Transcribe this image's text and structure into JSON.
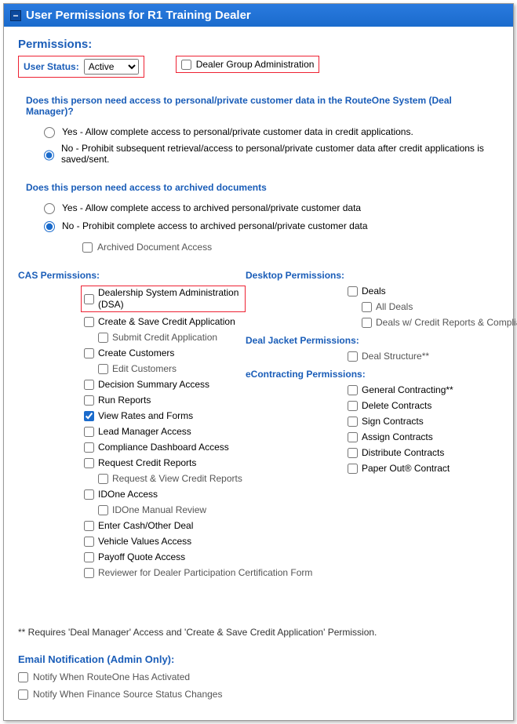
{
  "title": "User Permissions for R1 Training Dealer",
  "permissionsHeading": "Permissions:",
  "userStatus": {
    "label": "User Status:",
    "value": "Active"
  },
  "dealerGroupAdmin": "Dealer Group Administration",
  "q1": {
    "heading": "Does this person need access to personal/private customer data in the RouteOne System (Deal Manager)?",
    "yes": "Yes - Allow complete access to personal/private customer data in credit applications.",
    "no": "No - Prohibit subsequent retrieval/access to personal/private customer data after credit applications is saved/sent."
  },
  "q2": {
    "heading": "Does this person need access to archived documents",
    "yes": "Yes - Allow complete access to archived personal/private customer data",
    "no": "No - Prohibit complete access to archived personal/private customer data",
    "archived": "Archived Document Access"
  },
  "casHeading": "CAS Permissions:",
  "cas": {
    "dsa": "Dealership System Administration (DSA)",
    "createSave": "Create & Save Credit Application",
    "submit": "Submit Credit Application",
    "createCust": "Create Customers",
    "editCust": "Edit Customers",
    "decision": "Decision Summary Access",
    "runReports": "Run Reports",
    "viewRates": "View Rates and Forms",
    "leadMgr": "Lead Manager Access",
    "compliance": "Compliance Dashboard Access",
    "reqCredit": "Request Credit Reports",
    "reqView": "Request & View Credit Reports",
    "idone": "IDOne Access",
    "idoneManual": "IDOne Manual Review",
    "enterCash": "Enter Cash/Other Deal",
    "vehicleValues": "Vehicle Values Access",
    "payoff": "Payoff Quote Access",
    "reviewer": "Reviewer for Dealer Participation Certification Form"
  },
  "desktopHeading": "Desktop Permissions:",
  "desktop": {
    "deals": "Deals",
    "allDeals": "All Deals",
    "dealsCredit": "Deals w/ Credit Reports & Compliance"
  },
  "dealJacketHeading": "Deal Jacket Permissions:",
  "dealJacket": {
    "dealStructure": "Deal Structure**"
  },
  "econHeading": "eContracting Permissions:",
  "econ": {
    "general": "General Contracting**",
    "delete": "Delete Contracts",
    "sign": "Sign Contracts",
    "assign": "Assign Contracts",
    "distribute": "Distribute Contracts",
    "paperOut": "Paper Out® Contract"
  },
  "footnote": "** Requires 'Deal Manager' Access and 'Create & Save Credit Application' Permission.",
  "emailHeading": "Email Notification (Admin Only):",
  "email": {
    "activated": "Notify When RouteOne Has Activated",
    "finSource": "Notify When Finance Source Status Changes"
  }
}
